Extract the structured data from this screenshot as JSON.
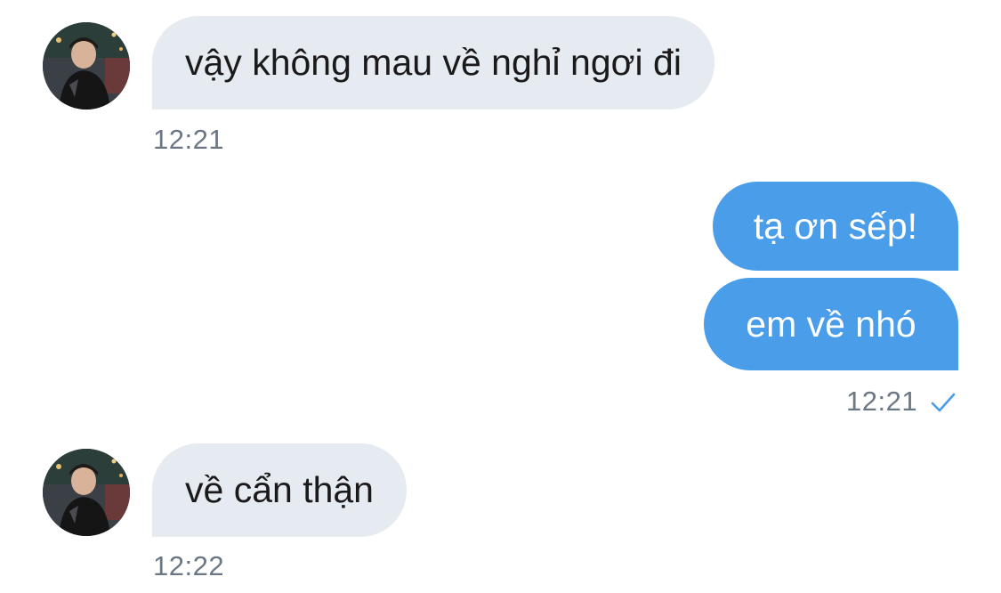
{
  "conversation": {
    "messages": [
      {
        "direction": "incoming",
        "text": "vậy không mau về nghỉ ngơi đi",
        "time": "12:21"
      },
      {
        "direction": "outgoing",
        "text": "tạ ơn sếp!"
      },
      {
        "direction": "outgoing",
        "text": "em về nhó",
        "time": "12:21",
        "status_icon": "checkmark-icon"
      },
      {
        "direction": "incoming",
        "text": "về cẩn thận",
        "time": "12:22"
      }
    ]
  },
  "colors": {
    "incoming_bubble": "#e6eaf1",
    "outgoing_bubble": "#4a9de9",
    "timestamp": "#6b7784",
    "read_check": "#4a9de9"
  }
}
